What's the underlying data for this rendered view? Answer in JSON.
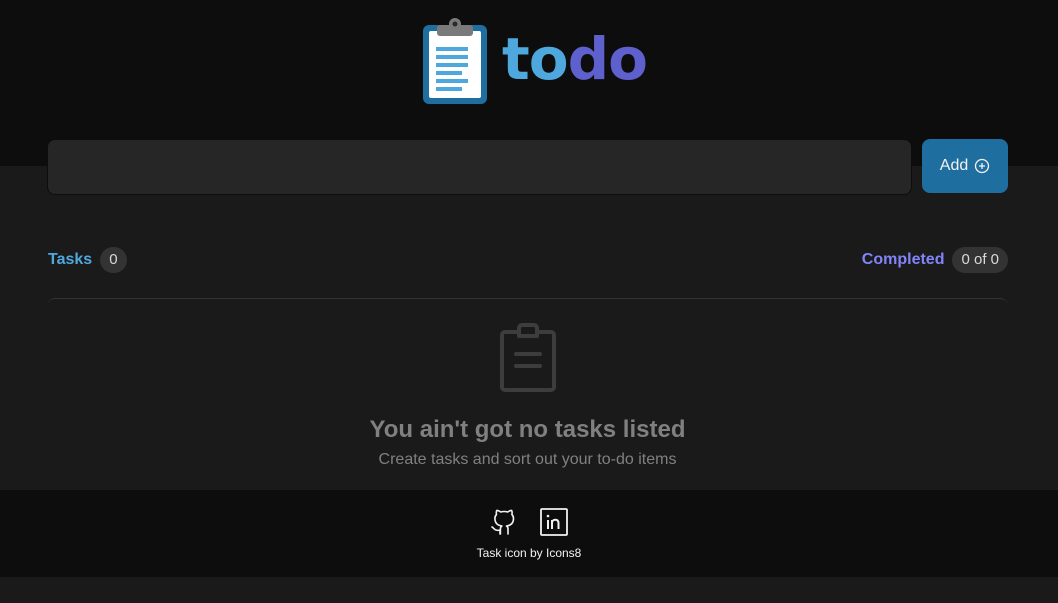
{
  "app": {
    "logo_part1": "to",
    "logo_part2": "do"
  },
  "add_form": {
    "input_value": "",
    "input_placeholder": "",
    "add_label": "Add"
  },
  "counters": {
    "tasks_label": "Tasks",
    "tasks_count": "0",
    "completed_label": "Completed",
    "completed_count": "0 of 0"
  },
  "empty_state": {
    "icon": "clipboard-icon",
    "title": "You ain't got no tasks listed",
    "subtitle": "Create tasks and sort out your to-do items"
  },
  "footer": {
    "links": [
      "github-icon",
      "linkedin-icon"
    ],
    "credit": "Task icon by Icons8"
  },
  "colors": {
    "blue": "#4ea8de",
    "purple": "#5e60ce",
    "purple_light": "#8284fa",
    "button": "#1e6f9f",
    "bg": "#1a1a1a",
    "header_bg": "#0d0d0d"
  }
}
